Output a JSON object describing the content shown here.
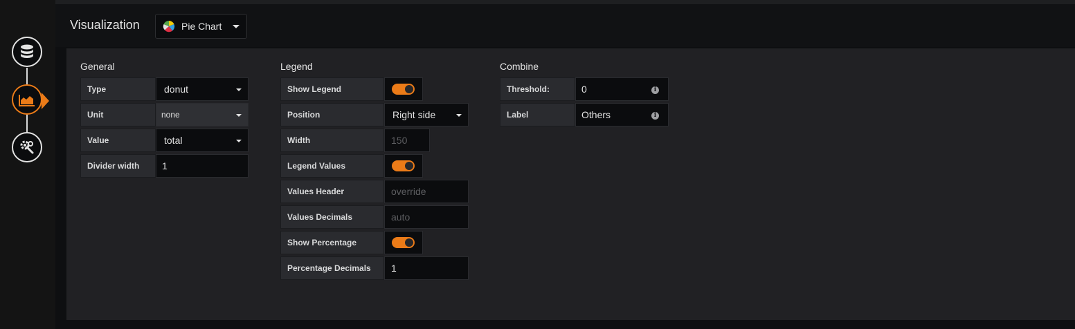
{
  "top_bar": {
    "title": "Visualization",
    "viz_picker": {
      "label": "Pie Chart",
      "icon": "pie-chart-icon"
    }
  },
  "steps": [
    {
      "icon": "database-icon",
      "active": false
    },
    {
      "icon": "area-chart-icon",
      "active": true
    },
    {
      "icon": "wrench-gear-icon",
      "active": false
    }
  ],
  "colors": {
    "accent": "#eb7b18",
    "panel": "#212124",
    "background": "#0e0f11"
  },
  "general": {
    "title": "General",
    "type": {
      "label": "Type",
      "value": "donut"
    },
    "unit": {
      "label": "Unit",
      "value": "none"
    },
    "value": {
      "label": "Value",
      "value": "total"
    },
    "divider_width": {
      "label": "Divider width",
      "value": "1"
    }
  },
  "legend": {
    "title": "Legend",
    "show_legend": {
      "label": "Show Legend",
      "on": true
    },
    "position": {
      "label": "Position",
      "value": "Right side"
    },
    "width": {
      "label": "Width",
      "placeholder": "150"
    },
    "legend_values": {
      "label": "Legend Values",
      "on": true
    },
    "values_header": {
      "label": "Values Header",
      "placeholder": "override"
    },
    "values_decimals": {
      "label": "Values Decimals",
      "placeholder": "auto"
    },
    "show_percentage": {
      "label": "Show Percentage",
      "on": true
    },
    "percentage_decimals": {
      "label": "Percentage Decimals",
      "value": "1"
    }
  },
  "combine": {
    "title": "Combine",
    "threshold": {
      "label": "Threshold:",
      "value": "0",
      "info_icon": "i"
    },
    "label_row": {
      "label": "Label",
      "value": "Others",
      "info_icon": "i"
    }
  }
}
